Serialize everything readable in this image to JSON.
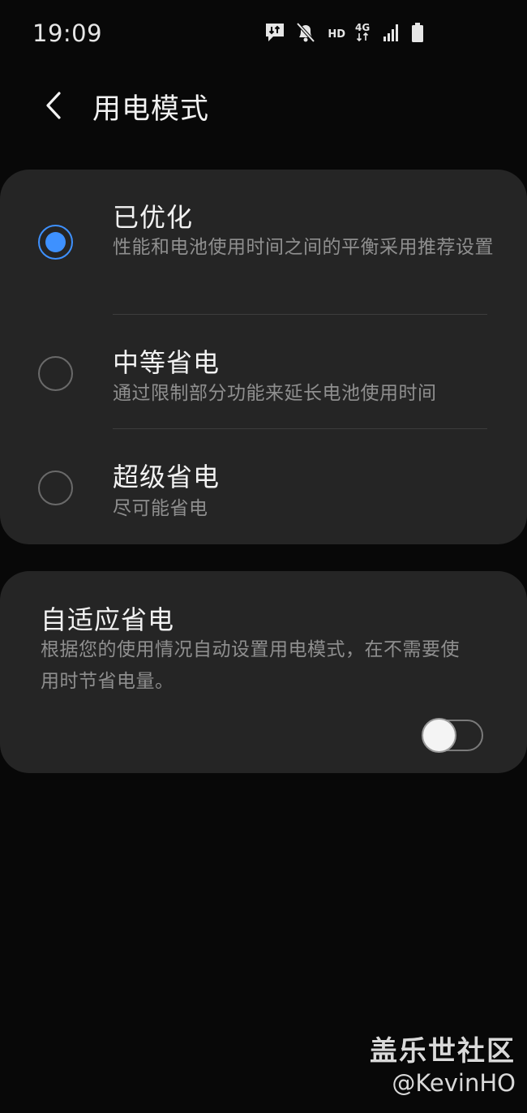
{
  "status_bar": {
    "time": "19:09",
    "hd_label": "HD",
    "network_label": "4G",
    "icons": [
      "message-data-icon",
      "mute-icon",
      "hd-voice-icon",
      "4g-data-icon",
      "signal-icon",
      "battery-icon"
    ]
  },
  "header": {
    "back_icon": "chevron-left-icon",
    "title": "用电模式"
  },
  "modes": [
    {
      "title": "已优化",
      "description": "性能和电池使用时间之间的平衡采用推荐设置",
      "selected": true
    },
    {
      "title": "中等省电",
      "description": "通过限制部分功能来延长电池使用时间",
      "selected": false
    },
    {
      "title": "超级省电",
      "description": "尽可能省电",
      "selected": false
    }
  ],
  "adaptive": {
    "title": "自适应省电",
    "description": "根据您的使用情况自动设置用电模式，在不需要使用时节省电量。",
    "enabled": false
  },
  "watermark": {
    "brand": "盖乐世社区",
    "user": "@KevinHO"
  },
  "colors": {
    "background": "#080808",
    "card": "#252525",
    "accent": "#3e91ff",
    "secondary_text": "#8f8f8f"
  }
}
